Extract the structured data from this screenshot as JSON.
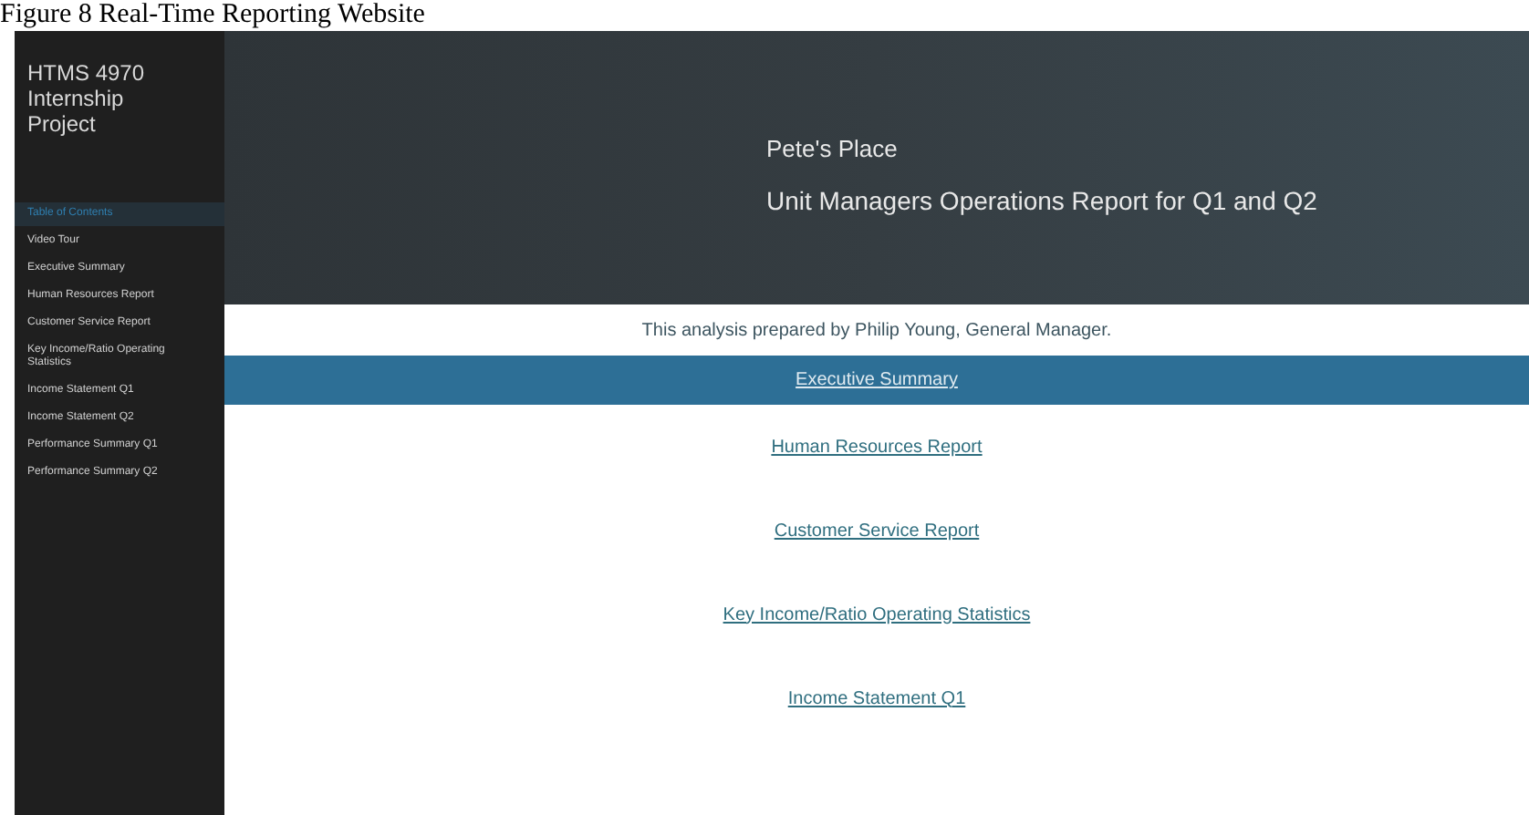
{
  "caption": "Figure 8 Real-Time Reporting Website",
  "sidebar": {
    "title": "HTMS 4970 Internship Project",
    "items": [
      {
        "label": "Table of Contents",
        "selected": true
      },
      {
        "label": "Video Tour",
        "selected": false
      },
      {
        "label": "Executive Summary",
        "selected": false
      },
      {
        "label": "Human Resources Report",
        "selected": false
      },
      {
        "label": "Customer Service Report",
        "selected": false
      },
      {
        "label": "Key Income/Ratio Operating Statistics",
        "selected": false
      },
      {
        "label": "Income Statement Q1",
        "selected": false
      },
      {
        "label": "Income Statement Q2",
        "selected": false
      },
      {
        "label": "Performance Summary Q1",
        "selected": false
      },
      {
        "label": "Performance Summary Q2",
        "selected": false
      }
    ]
  },
  "header": {
    "title": "Pete's Place",
    "subtitle": "Unit Managers Operations Report for Q1 and Q2"
  },
  "intro": "This analysis prepared by Philip Young, General Manager.",
  "links": [
    {
      "label": "Executive Summary",
      "selected": true
    },
    {
      "label": "Human Resources Report",
      "selected": false
    },
    {
      "label": "Customer Service Report",
      "selected": false
    },
    {
      "label": "Key Income/Ratio Operating Statistics",
      "selected": false
    },
    {
      "label": "Income Statement Q1",
      "selected": false
    }
  ]
}
